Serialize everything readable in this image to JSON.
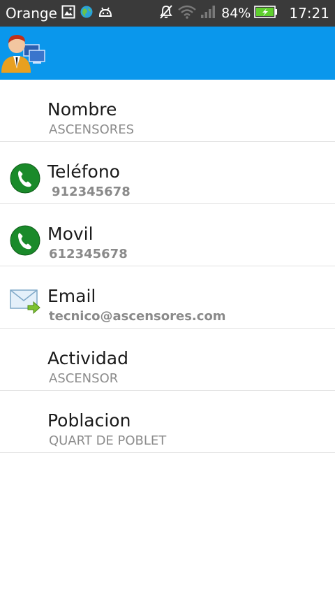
{
  "status_bar": {
    "carrier": "Orange",
    "battery": "84%",
    "time": "17:21",
    "icons": [
      "gallery-icon",
      "globe-icon",
      "android-icon",
      "mute-icon",
      "wifi-icon",
      "signal-icon",
      "battery-charging-icon"
    ]
  },
  "action_bar": {
    "app_icon": "contact-person-icon",
    "color": "#0a97ec"
  },
  "fields": [
    {
      "label": "Nombre",
      "value": "ASCENSORES",
      "icon": null
    },
    {
      "label": "Teléfono",
      "value": "912345678",
      "icon": "phone-icon"
    },
    {
      "label": "Movil",
      "value": "612345678",
      "icon": "phone-icon"
    },
    {
      "label": "Email",
      "value": "tecnico@ascensores.com",
      "icon": "email-icon"
    },
    {
      "label": "Actividad",
      "value": "ASCENSOR",
      "icon": null
    },
    {
      "label": "Poblacion",
      "value": "QUART DE POBLET",
      "icon": null
    }
  ],
  "colors": {
    "status_bar": "#3a3a3a",
    "action_bar": "#0a97ec",
    "phone_green": "#1a8a2a",
    "label_text": "#1a1a1a",
    "value_text": "#8c8c8c"
  }
}
